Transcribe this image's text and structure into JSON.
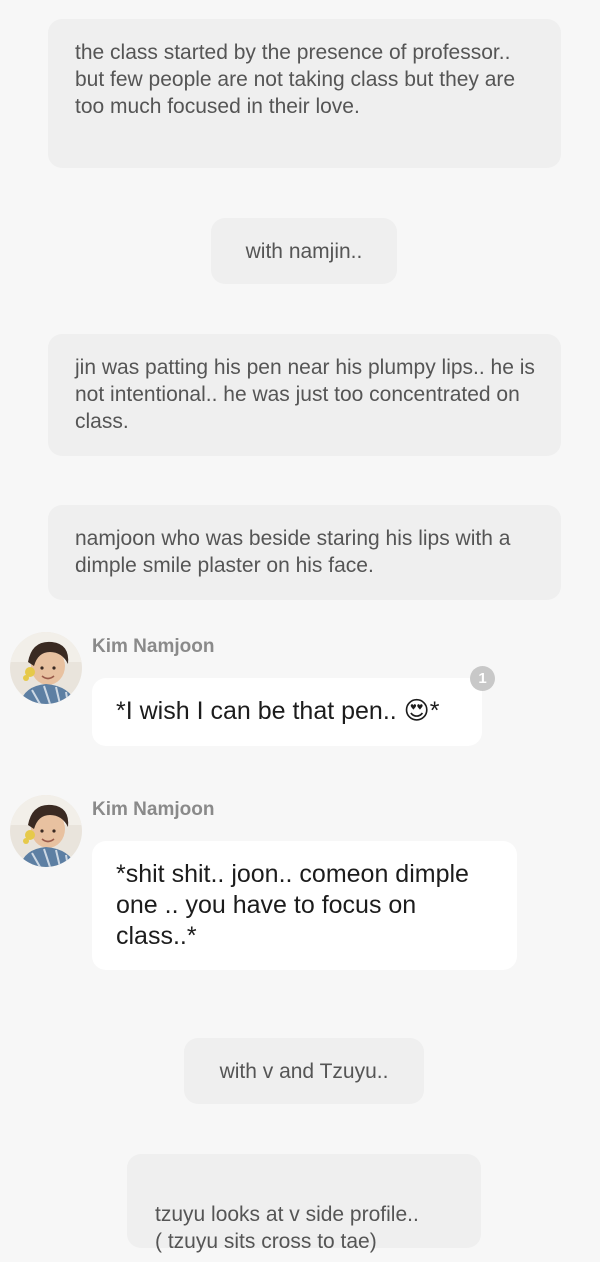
{
  "narrations": [
    {
      "text": "the class started by the presence of professor.. but few people are not taking class but they are too much focused in their love."
    },
    {
      "text": "with namjin.."
    },
    {
      "text": "jin was patting his pen near his plumpy lips.. he is not intentional.. he was just too concentrated on class."
    },
    {
      "text": "namjoon who was beside staring his lips with a dimple smile plaster on his face."
    },
    {
      "text": "with v and Tzuyu.."
    },
    {
      "text": "tzuyu looks at v side profile..\n( tzuyu sits cross to tae)"
    }
  ],
  "messages": [
    {
      "sender": "Kim Namjoon",
      "text": "*I wish I can be that pen.. 😍*",
      "badge": "1"
    },
    {
      "sender": "Kim Namjoon",
      "text": "*shit shit.. joon.. comeon dimple one .. you have to focus on class..*"
    }
  ],
  "colors": {
    "background": "#f7f7f7",
    "narration_bg": "#efefef",
    "bubble_bg": "#ffffff",
    "sender_text": "#8a8a8a",
    "badge_bg": "#c8c8c8"
  },
  "icons": {
    "avatar": "profile-photo",
    "badge": "unread-count-badge"
  }
}
